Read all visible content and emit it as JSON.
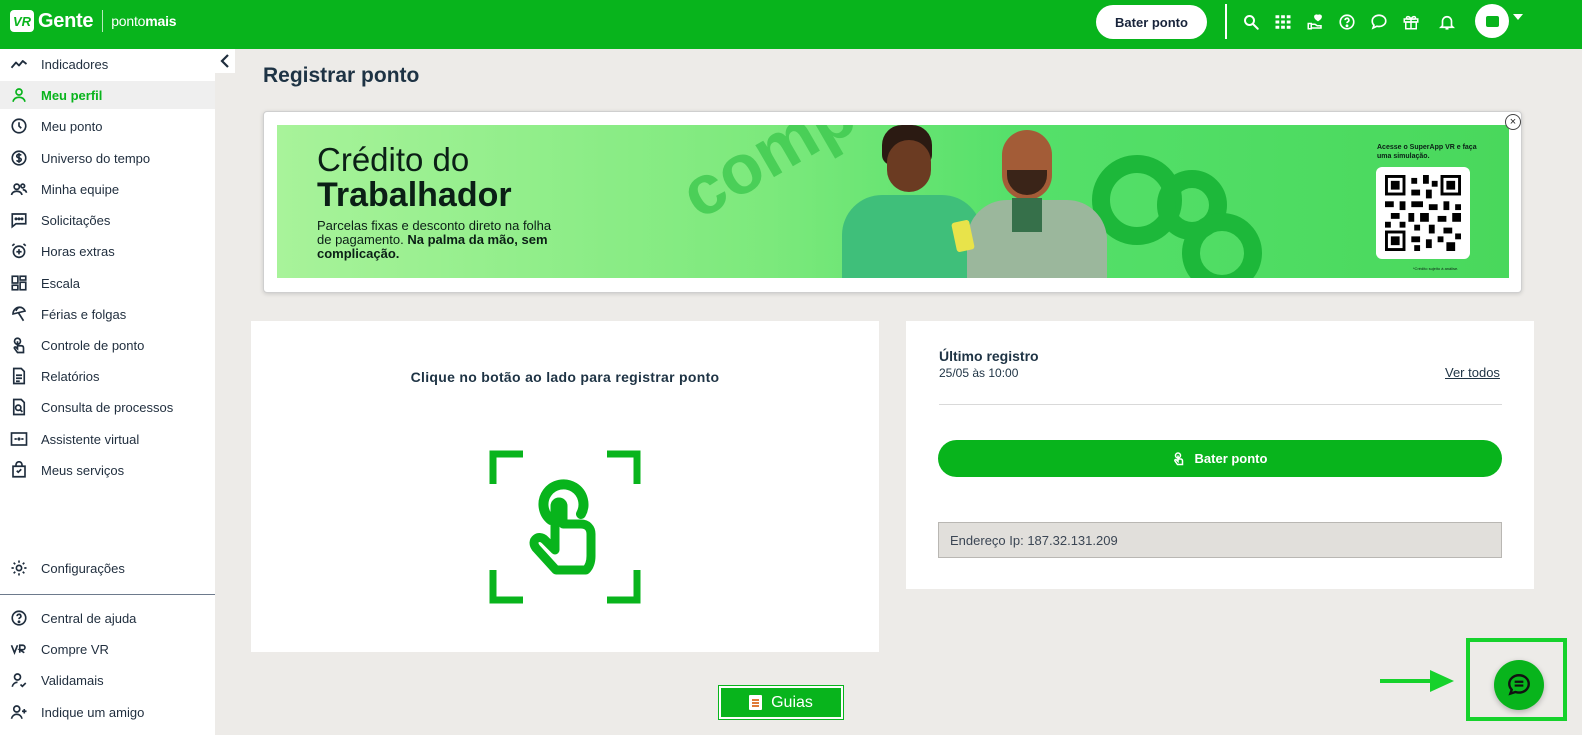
{
  "brand": {
    "logo_mark": "VR",
    "name": "Gente",
    "product_prefix": "ponto",
    "product_suffix": "mais",
    "accent": "#08b41c"
  },
  "topbar": {
    "clock_button": "Bater ponto",
    "icons": [
      "search-icon",
      "apps-grid-icon",
      "hand-heart-icon",
      "help-icon",
      "chat-bubble-icon",
      "gift-icon",
      "bell-icon"
    ]
  },
  "sidebar": {
    "items": [
      {
        "label": "Indicadores",
        "icon": "chart-line-icon"
      },
      {
        "label": "Meu perfil",
        "icon": "user-icon",
        "active": true
      },
      {
        "label": "Meu ponto",
        "icon": "clock-icon"
      },
      {
        "label": "Universo do tempo",
        "icon": "dollar-circle-icon"
      },
      {
        "label": "Minha equipe",
        "icon": "team-icon"
      },
      {
        "label": "Solicitações",
        "icon": "message-dots-icon"
      },
      {
        "label": "Horas extras",
        "icon": "alarm-plus-icon"
      },
      {
        "label": "Escala",
        "icon": "dashboard-icon"
      },
      {
        "label": "Férias e folgas",
        "icon": "beach-umbrella-icon"
      },
      {
        "label": "Controle de ponto",
        "icon": "touch-icon"
      },
      {
        "label": "Relatórios",
        "icon": "document-icon"
      },
      {
        "label": "Consulta de processos",
        "icon": "document-search-icon"
      },
      {
        "label": "Assistente virtual",
        "icon": "robot-icon"
      },
      {
        "label": "Meus serviços",
        "icon": "shopping-bag-icon"
      }
    ],
    "settings": "Configurações",
    "bottom_items": [
      {
        "label": "Central de ajuda",
        "icon": "help-circle-icon"
      },
      {
        "label": "Compre VR",
        "icon": "vr-logo-icon"
      },
      {
        "label": "Validamais",
        "icon": "user-check-icon"
      },
      {
        "label": "Indique um amigo",
        "icon": "user-plus-icon"
      }
    ]
  },
  "main": {
    "title": "Registrar ponto",
    "banner": {
      "headline1": "Crédito do",
      "headline2": "Trabalhador",
      "subtitle": "Parcelas fixas e desconto direto na folha de pagamento.",
      "subtitle_bold": "Na palma da mão, sem complicação.",
      "watermark": "complicação",
      "qr_caption": "Acesse o SuperApp VR e faça uma simulação.",
      "footnote": "*Crédito sujeito à análise.",
      "close": "×"
    },
    "register_card": {
      "instruction": "Clique no botão ao lado para registrar ponto"
    },
    "last_record": {
      "title": "Último registro",
      "date": "25/05 às 10:00",
      "see_all": "Ver todos",
      "button": "Bater ponto",
      "ip": "Endereço Ip: 187.32.131.209"
    },
    "guias": "Guias"
  }
}
